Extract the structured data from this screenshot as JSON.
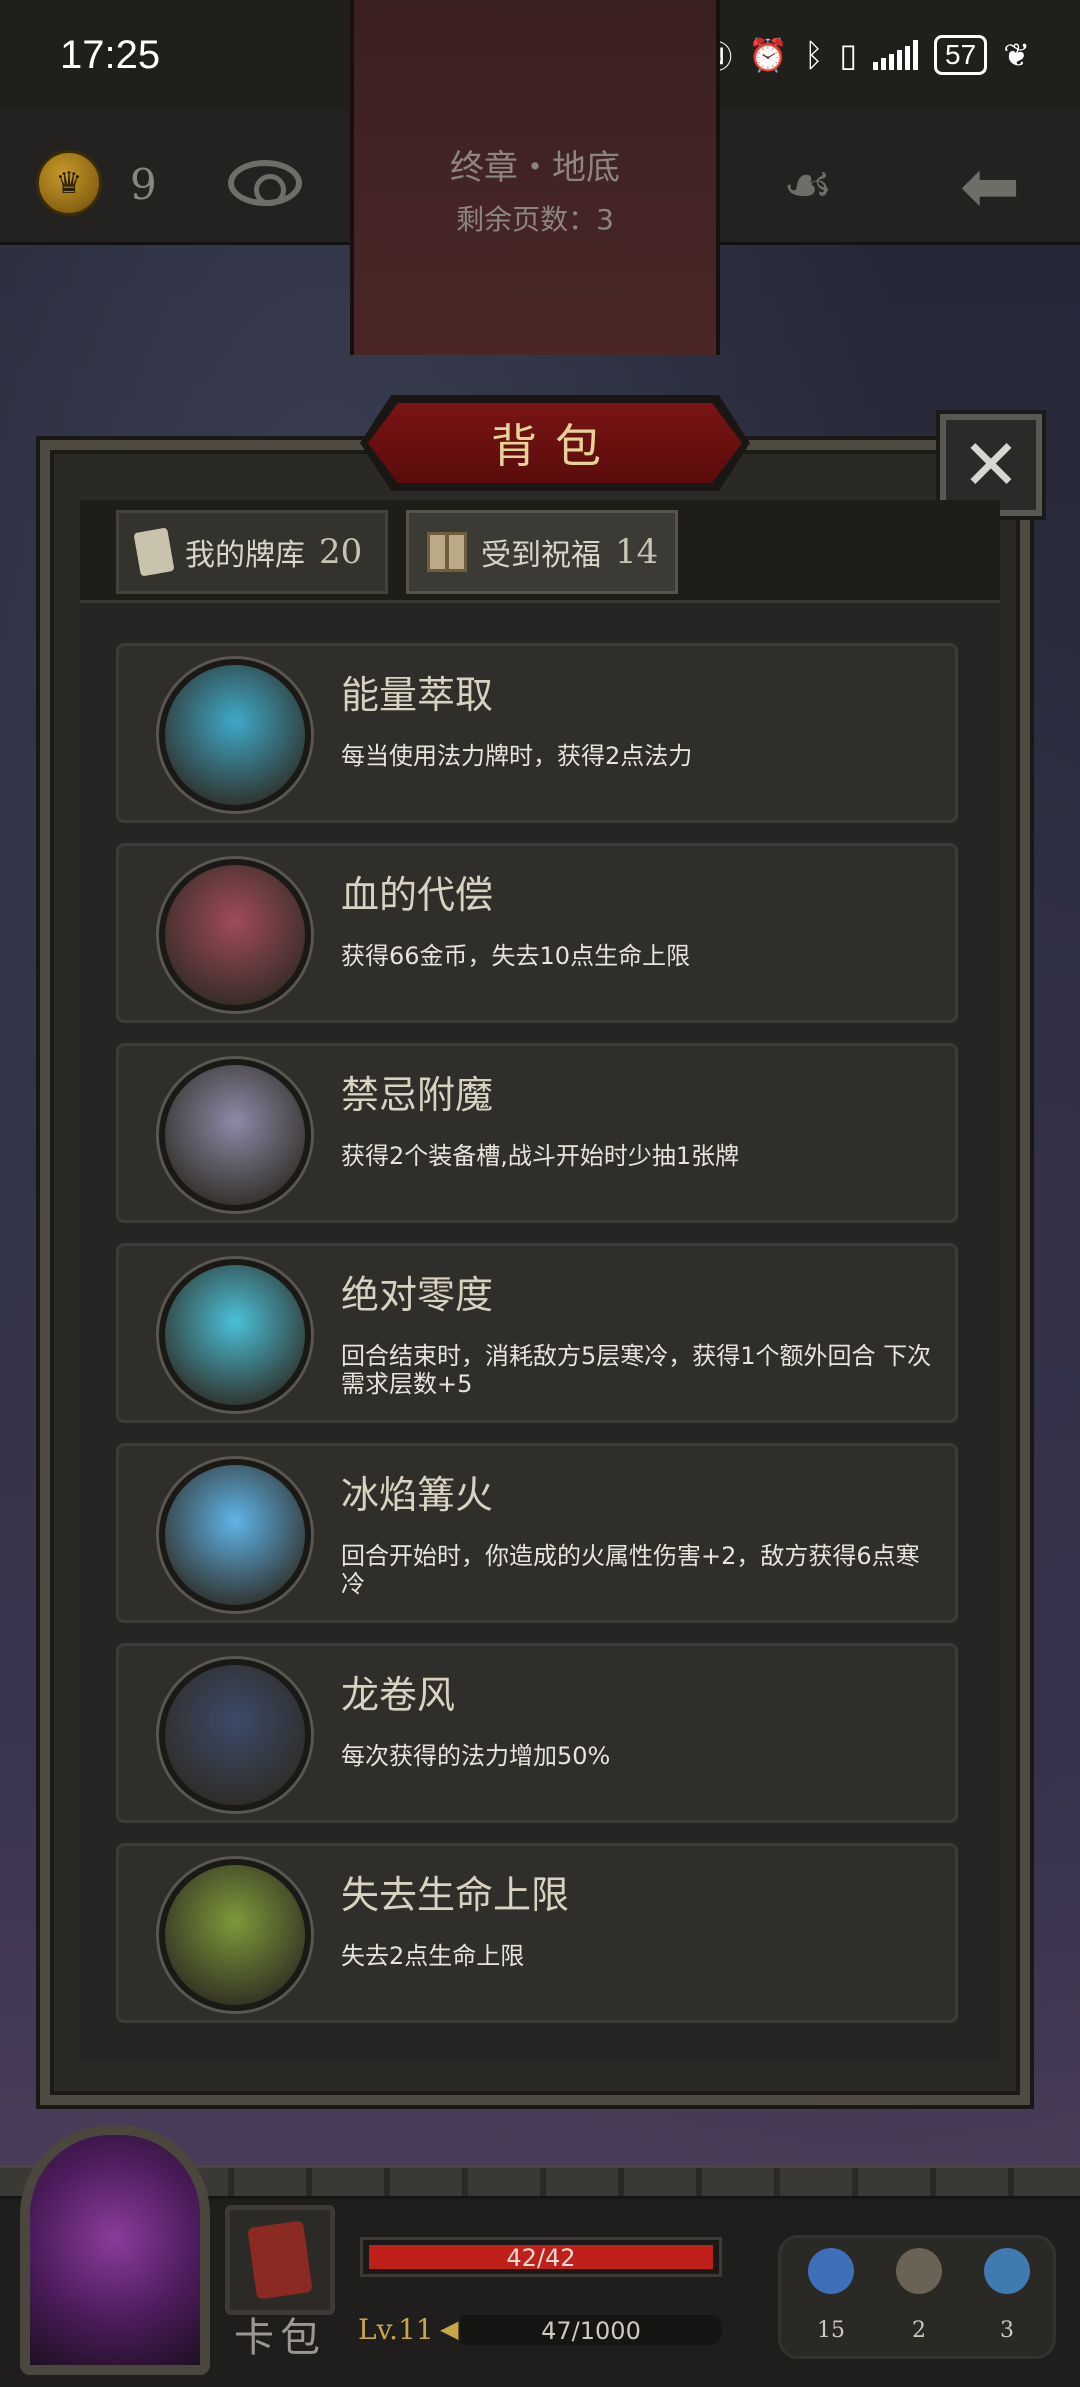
{
  "status_bar": {
    "time": "17:25",
    "battery": "57",
    "icons": [
      "nfc-icon",
      "alarm-icon",
      "bluetooth-icon",
      "vibrate-icon",
      "signal-icon",
      "battery-icon",
      "leaf-icon"
    ]
  },
  "header": {
    "coin_count": "9",
    "chapter_title": "终章・地底",
    "pages_remaining": "剩余页数：3"
  },
  "modal": {
    "title": "背包",
    "close_glyph": "✕",
    "tabs": [
      {
        "label": "我的牌库",
        "count": "20"
      },
      {
        "label": "受到祝福",
        "count": "14"
      }
    ],
    "items": [
      {
        "name": "能量萃取",
        "description": "每当使用法力牌时，获得2点法力",
        "icon": "energy-extract-icon",
        "color": "#3fa9c9"
      },
      {
        "name": "血的代偿",
        "description": "获得66金币，失去10点生命上限",
        "icon": "vampire-icon",
        "color": "#a04b5a"
      },
      {
        "name": "禁忌附魔",
        "description": "获得2个装备槽,战斗开始时少抽1张牌",
        "icon": "forbidden-enchant-icon",
        "color": "#8c8aa8"
      },
      {
        "name": "绝对零度",
        "description": "回合结束时，消耗敌方5层寒冷，获得1个额外回合 下次需求层数+5",
        "icon": "absolute-zero-icon",
        "color": "#4ac0d8"
      },
      {
        "name": "冰焰篝火",
        "description": "回合开始时，你造成的火属性伤害+2，敌方获得6点寒冷",
        "icon": "ice-bonfire-icon",
        "color": "#5fb4e8"
      },
      {
        "name": "龙卷风",
        "description": "每次获得的法力增加50%",
        "icon": "tornado-icon",
        "color": "#3b4a6a"
      },
      {
        "name": "失去生命上限",
        "description": "失去2点生命上限",
        "icon": "ghoul-icon",
        "color": "#7c9a3a"
      }
    ]
  },
  "bottom": {
    "card_bag_label": "卡包",
    "hp_text": "42/42",
    "hp_fraction": 1.0,
    "level": "Lv.11",
    "xp_text": "47/1000",
    "inventory": [
      {
        "icon": "potion-icon",
        "count": "15",
        "color": "#3f6fb8"
      },
      {
        "icon": "hourglass-icon",
        "count": "2",
        "color": "#6b6256"
      },
      {
        "icon": "cards-icon",
        "count": "3",
        "color": "#3f7ab0"
      }
    ]
  }
}
